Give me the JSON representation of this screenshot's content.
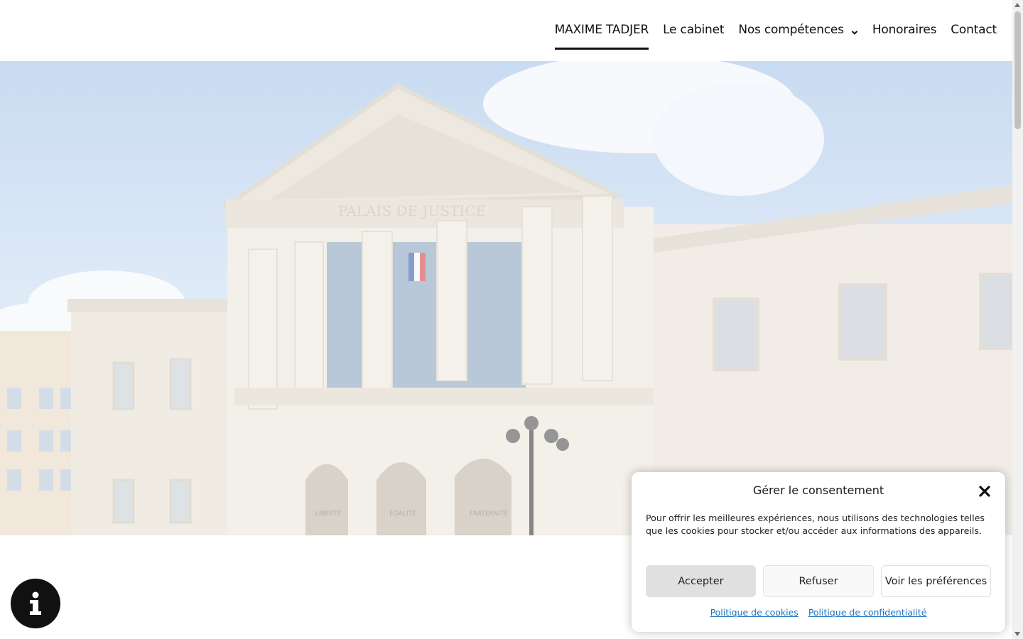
{
  "nav": {
    "items": [
      {
        "label": "MAXIME TADJER",
        "active": true
      },
      {
        "label": "Le cabinet"
      },
      {
        "label": "Nos compétences",
        "dropdown": true
      },
      {
        "label": "Honoraires"
      },
      {
        "label": "Contact"
      }
    ]
  },
  "hero": {
    "image_alt": "Palais de Justice",
    "inscription": "PALAIS DE JUSTICE",
    "arch_labels": [
      "LIBERTÉ",
      "ÉGALITÉ",
      "FRATERNITÉ"
    ]
  },
  "cookie": {
    "title": "Gérer le consentement",
    "text": "Pour offrir les meilleures expériences, nous utilisons des technologies telles que les cookies pour stocker et/ou accéder aux informations des appareils.",
    "accept_label": "Accepter",
    "refuse_label": "Refuser",
    "prefs_label": "Voir les préférences",
    "cookie_policy_label": "Politique de cookies",
    "privacy_policy_label": "Politique de confidentialité"
  },
  "info_button": {
    "icon": "info-icon",
    "glyph": "i"
  },
  "colors": {
    "text": "#111111",
    "link": "#1e73be",
    "accept_bg": "#e0e0e0"
  }
}
